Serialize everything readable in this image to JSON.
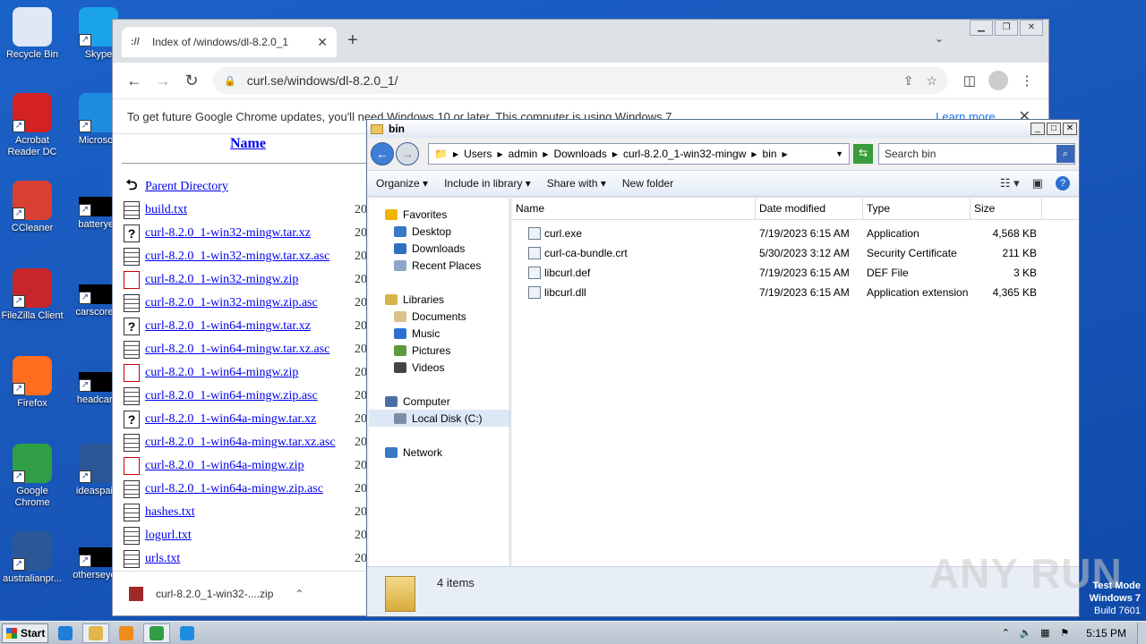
{
  "desktop": {
    "icons": [
      {
        "label": "Recycle Bin",
        "icon": "recycle-bin-icon",
        "color": "#dfe9f5"
      },
      {
        "label": "Skype",
        "icon": "skype-icon",
        "color": "#1aa3e8"
      },
      {
        "label": "Acrobat Reader DC",
        "icon": "acrobat-icon",
        "color": "#d42222"
      },
      {
        "label": "Microsoft",
        "icon": "edge-icon",
        "color": "#1e8de0"
      },
      {
        "label": "CCleaner",
        "icon": "ccleaner-icon",
        "color": "#d94032"
      },
      {
        "label": "batteryey",
        "icon": "blank-file-icon",
        "color": "#000000"
      },
      {
        "label": "FileZilla Client",
        "icon": "filezilla-icon",
        "color": "#c8262a"
      },
      {
        "label": "carscore...",
        "icon": "blank-file-icon",
        "color": "#000000"
      },
      {
        "label": "Firefox",
        "icon": "firefox-icon",
        "color": "#ff6d1f"
      },
      {
        "label": "headcar...",
        "icon": "blank-file-icon",
        "color": "#000000"
      },
      {
        "label": "Google Chrome",
        "icon": "chrome-icon",
        "color": "#2f9e44"
      },
      {
        "label": "ideaspai...",
        "icon": "word-doc-icon",
        "color": "#2b5797"
      },
      {
        "label": "australianpr...",
        "icon": "word-doc-icon",
        "color": "#2b5797"
      },
      {
        "label": "otherseye...",
        "icon": "blank-file-icon",
        "color": "#000000"
      }
    ]
  },
  "chrome": {
    "tab_title": "Index of /windows/dl-8.2.0_1",
    "url": "curl.se/windows/dl-8.2.0_1/",
    "infobar_message": "To get future Google Chrome updates, you'll need Windows 10 or later. This computer is using Windows 7.",
    "infobar_link": "Learn more",
    "page": {
      "name_header": "Name",
      "parent": "Parent Directory",
      "files": [
        {
          "name": "build.txt",
          "kind": "txt",
          "year": "20"
        },
        {
          "name": "curl-8.2.0_1-win32-mingw.tar.xz",
          "kind": "unknown",
          "year": "20"
        },
        {
          "name": "curl-8.2.0_1-win32-mingw.tar.xz.asc",
          "kind": "txt",
          "year": "20"
        },
        {
          "name": "curl-8.2.0_1-win32-mingw.zip",
          "kind": "zip",
          "year": "20"
        },
        {
          "name": "curl-8.2.0_1-win32-mingw.zip.asc",
          "kind": "txt",
          "year": "20"
        },
        {
          "name": "curl-8.2.0_1-win64-mingw.tar.xz",
          "kind": "unknown",
          "year": "20"
        },
        {
          "name": "curl-8.2.0_1-win64-mingw.tar.xz.asc",
          "kind": "txt",
          "year": "20"
        },
        {
          "name": "curl-8.2.0_1-win64-mingw.zip",
          "kind": "zip",
          "year": "20"
        },
        {
          "name": "curl-8.2.0_1-win64-mingw.zip.asc",
          "kind": "txt",
          "year": "20"
        },
        {
          "name": "curl-8.2.0_1-win64a-mingw.tar.xz",
          "kind": "unknown",
          "year": "20"
        },
        {
          "name": "curl-8.2.0_1-win64a-mingw.tar.xz.asc",
          "kind": "txt",
          "year": "20"
        },
        {
          "name": "curl-8.2.0_1-win64a-mingw.zip",
          "kind": "zip",
          "year": "20"
        },
        {
          "name": "curl-8.2.0_1-win64a-mingw.zip.asc",
          "kind": "txt",
          "year": "20"
        },
        {
          "name": "hashes.txt",
          "kind": "txt",
          "year": "20"
        },
        {
          "name": "logurl.txt",
          "kind": "txt",
          "year": "20"
        },
        {
          "name": "urls.txt",
          "kind": "txt",
          "year": "20"
        }
      ]
    },
    "download": {
      "filename": "curl-8.2.0_1-win32-....zip"
    }
  },
  "explorer": {
    "title": "bin",
    "breadcrumb": [
      "Users",
      "admin",
      "Downloads",
      "curl-8.2.0_1-win32-mingw",
      "bin"
    ],
    "search_placeholder": "Search bin",
    "commands": [
      "Organize",
      "Include in library",
      "Share with",
      "New folder"
    ],
    "nav": [
      {
        "label": "Favorites",
        "level": 0,
        "icon": "star-icon",
        "color": "#f0b400"
      },
      {
        "label": "Desktop",
        "level": 1,
        "icon": "desktop-icon",
        "color": "#3a78c8"
      },
      {
        "label": "Downloads",
        "level": 1,
        "icon": "downloads-icon",
        "color": "#2f6fbf"
      },
      {
        "label": "Recent Places",
        "level": 1,
        "icon": "recent-places-icon",
        "color": "#8aa6c8"
      },
      {
        "label": "",
        "level": 0,
        "icon": "",
        "color": ""
      },
      {
        "label": "Libraries",
        "level": 0,
        "icon": "libraries-icon",
        "color": "#d9b44a"
      },
      {
        "label": "Documents",
        "level": 1,
        "icon": "documents-icon",
        "color": "#d9c38a"
      },
      {
        "label": "Music",
        "level": 1,
        "icon": "music-icon",
        "color": "#2d6fd1"
      },
      {
        "label": "Pictures",
        "level": 1,
        "icon": "pictures-icon",
        "color": "#5c9a3c"
      },
      {
        "label": "Videos",
        "level": 1,
        "icon": "videos-icon",
        "color": "#444444"
      },
      {
        "label": "",
        "level": 0,
        "icon": "",
        "color": ""
      },
      {
        "label": "Computer",
        "level": 0,
        "icon": "computer-icon",
        "color": "#4a6fa5"
      },
      {
        "label": "Local Disk (C:)",
        "level": 1,
        "icon": "local-disk-icon",
        "color": "#7b8ea8",
        "selected": true
      },
      {
        "label": "",
        "level": 0,
        "icon": "",
        "color": ""
      },
      {
        "label": "Network",
        "level": 0,
        "icon": "network-icon",
        "color": "#3a78c8"
      }
    ],
    "columns": [
      "Name",
      "Date modified",
      "Type",
      "Size"
    ],
    "files": [
      {
        "name": "curl.exe",
        "date": "7/19/2023 6:15 AM",
        "type": "Application",
        "size": "4,568 KB"
      },
      {
        "name": "curl-ca-bundle.crt",
        "date": "5/30/2023 3:12 AM",
        "type": "Security Certificate",
        "size": "211 KB"
      },
      {
        "name": "libcurl.def",
        "date": "7/19/2023 6:15 AM",
        "type": "DEF File",
        "size": "3 KB"
      },
      {
        "name": "libcurl.dll",
        "date": "7/19/2023 6:15 AM",
        "type": "Application extension",
        "size": "4,365 KB"
      }
    ],
    "item_count": "4 items"
  },
  "watermark": "ANY RUN",
  "test_mode": {
    "line1": "Test Mode",
    "line2": "Windows 7",
    "line3": "Build 7601"
  },
  "taskbar": {
    "start": "Start",
    "apps": [
      {
        "icon": "ie-icon",
        "color": "#1f7fd6",
        "active": false
      },
      {
        "icon": "explorer-icon",
        "color": "#e0b54a",
        "active": true
      },
      {
        "icon": "media-player-icon",
        "color": "#f08a1a",
        "active": false
      },
      {
        "icon": "chrome-icon",
        "color": "#2f9e44",
        "active": true
      },
      {
        "icon": "edge-icon",
        "color": "#1e8de0",
        "active": false
      }
    ],
    "clock": "5:15 PM"
  }
}
